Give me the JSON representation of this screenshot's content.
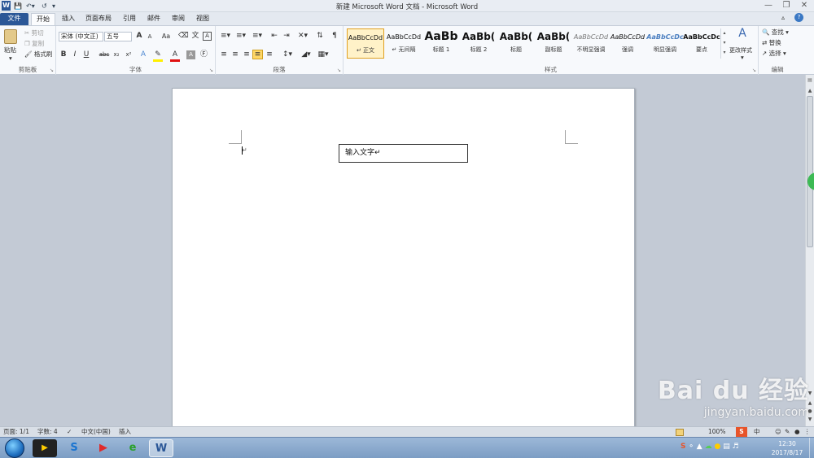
{
  "window": {
    "title": "新建 Microsoft Word 文档 - Microsoft Word",
    "app_icon": "W"
  },
  "tabs": [
    "文件",
    "开始",
    "插入",
    "页面布局",
    "引用",
    "邮件",
    "审阅",
    "视图"
  ],
  "clipboard": {
    "paste": "粘贴",
    "cut": "剪切",
    "copy": "复制",
    "format_painter": "格式刷",
    "label": "剪贴板"
  },
  "font": {
    "name": "宋体 (中文正)",
    "size": "五号",
    "label": "字体",
    "grow": "A",
    "shrink": "A",
    "change_case": "Aa",
    "bold": "B",
    "italic": "I",
    "underline": "U",
    "strike": "abc",
    "sub": "x₂",
    "sup": "x²",
    "font_color": "A"
  },
  "paragraph": {
    "label": "段落"
  },
  "styles": {
    "label": "样式",
    "change_styles": "更改样式",
    "items": [
      {
        "sample": "AaBbCcDd",
        "name": "↵ 正文"
      },
      {
        "sample": "AaBbCcDd",
        "name": "↵ 无间隔"
      },
      {
        "sample": "AaBb",
        "name": "标题 1"
      },
      {
        "sample": "AaBb(",
        "name": "标题 2"
      },
      {
        "sample": "AaBb(",
        "name": "标题"
      },
      {
        "sample": "AaBb(",
        "name": "副标题"
      },
      {
        "sample": "AaBbCcDd",
        "name": "不明显强调"
      },
      {
        "sample": "AaBbCcDd",
        "name": "强调"
      },
      {
        "sample": "AaBbCcDc",
        "name": "明显强调"
      },
      {
        "sample": "AaBbCcDc",
        "name": "要点"
      }
    ]
  },
  "editing": {
    "find": "查找",
    "replace": "替换",
    "select": "选择",
    "label": "编辑"
  },
  "document": {
    "textbox_text": "输入文字↵",
    "paragraph_mark": "↵"
  },
  "status": {
    "page": "页面: 1/1",
    "words": "字数: 4",
    "language": "中文(中国)",
    "mode": "插入",
    "zoom": "100%"
  },
  "clock": {
    "time": "12:30",
    "date": "2017/8/17"
  },
  "watermark": {
    "brand": "Bai du 经验",
    "url": "jingyan.baidu.com"
  }
}
